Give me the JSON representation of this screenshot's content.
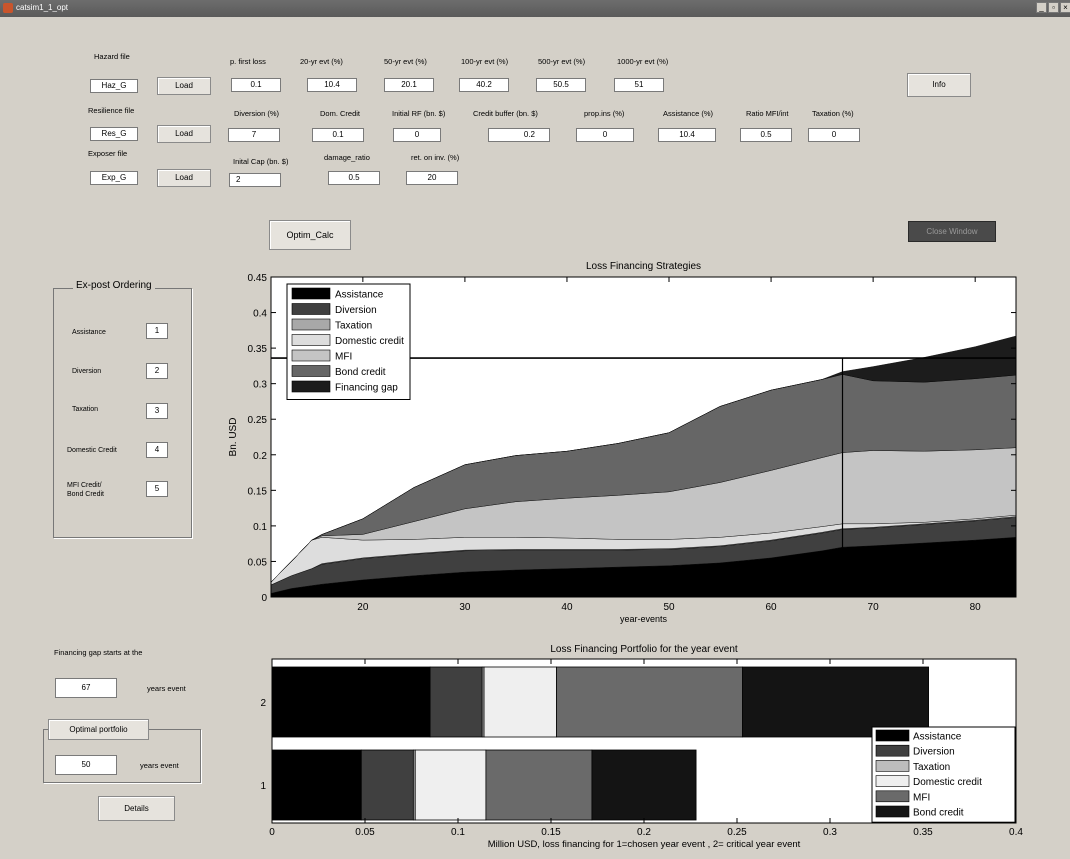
{
  "window": {
    "title": "catsim1_1_opt",
    "controls": [
      "_",
      "▫",
      "×"
    ]
  },
  "inputs": {
    "hazard_file": {
      "label": "Hazard file",
      "value": "Haz_G",
      "button": "Load"
    },
    "resilience_file": {
      "label": "Resilience file",
      "value": "Res_G",
      "button": "Load"
    },
    "exposer_file": {
      "label": "Exposer file",
      "value": "Exp_G",
      "button": "Load"
    },
    "p_first_loss": {
      "label": "p. first loss",
      "value": "0.1"
    },
    "evt20": {
      "label": "20-yr evt (%)",
      "value": "10.4"
    },
    "evt50": {
      "label": "50-yr evt (%)",
      "value": "20.1"
    },
    "evt100": {
      "label": "100-yr evt (%)",
      "value": "40.2"
    },
    "evt500": {
      "label": "500-yr evt (%)",
      "value": "50.5"
    },
    "evt1000": {
      "label": "1000-yr evt (%)",
      "value": "51"
    },
    "diversion": {
      "label": "Diversion (%)",
      "value": "7"
    },
    "dom_credit": {
      "label": "Dom. Credit",
      "value": "0.1"
    },
    "initial_rf": {
      "label": "Initial RF (bn. $)",
      "value": "0"
    },
    "credit_buffer": {
      "label": "Credit buffer (bn. $)",
      "value": "0.2"
    },
    "prop_ins": {
      "label": "prop.ins (%)",
      "value": "0"
    },
    "assistance": {
      "label": "Assistance (%)",
      "value": "10.4"
    },
    "ratio_mfi": {
      "label": "Ratio MFI/int",
      "value": "0.5"
    },
    "taxation": {
      "label": "Taxation (%)",
      "value": "0"
    },
    "initial_cap": {
      "label": "Inital Cap (bn. $)",
      "value": "2"
    },
    "damage_ratio": {
      "label": "damage_ratio",
      "value": "0.5"
    },
    "ret_on_inv": {
      "label": "ret. on inv. (%)",
      "value": "20"
    }
  },
  "buttons": {
    "info": "Info",
    "optim_calc": "Optim_Calc",
    "close_window": "Close Window",
    "optimal_portfolio": "Optimal portfolio",
    "details": "Details"
  },
  "ex_post": {
    "title": "Ex-post Ordering",
    "items": [
      {
        "label": "Assistance",
        "value": "1"
      },
      {
        "label": "Diversion",
        "value": "2"
      },
      {
        "label": "Taxation",
        "value": "3"
      },
      {
        "label": "Domestic Credit",
        "value": "4"
      },
      {
        "label": "MFI Credit/ Bond Credit",
        "value": "5"
      }
    ]
  },
  "financing_gap": {
    "label": "Financing gap starts at the",
    "value": "67",
    "suffix": "years event"
  },
  "optimal": {
    "value": "50",
    "suffix": "years event"
  },
  "colors": {
    "assistance": "#000000",
    "diversion": "#404040",
    "taxation": "#a8a8a8",
    "domestic_credit": "#dddddd",
    "mfi": "#c4c4c4",
    "bond_credit": "#666666",
    "financing_gap": "#1c1c1c"
  },
  "chart_data": [
    {
      "type": "area",
      "title": "Loss Financing Strategies",
      "xlabel": "year-events",
      "ylabel": "Bn. USD",
      "xlim": [
        11,
        84
      ],
      "ylim": [
        0,
        0.45
      ],
      "xticks": [
        20,
        30,
        40,
        50,
        60,
        70,
        80
      ],
      "yticks": [
        0,
        0.05,
        0.1,
        0.15,
        0.2,
        0.25,
        0.3,
        0.35,
        0.4,
        0.45
      ],
      "legend_position": "top-left",
      "x": [
        11,
        13,
        15,
        16,
        20,
        25,
        30,
        35,
        40,
        45,
        50,
        55,
        60,
        65,
        67,
        70,
        75,
        80,
        84
      ],
      "series": [
        {
          "name": "Assistance",
          "color": "#000000",
          "values": [
            0.005,
            0.012,
            0.016,
            0.018,
            0.024,
            0.03,
            0.035,
            0.038,
            0.04,
            0.042,
            0.044,
            0.048,
            0.055,
            0.065,
            0.07,
            0.072,
            0.076,
            0.08,
            0.084
          ]
        },
        {
          "name": "Diversion",
          "color": "#404040",
          "values": [
            0.012,
            0.018,
            0.024,
            0.028,
            0.03,
            0.03,
            0.03,
            0.028,
            0.026,
            0.024,
            0.023,
            0.023,
            0.024,
            0.025,
            0.025,
            0.025,
            0.026,
            0.027,
            0.028
          ]
        },
        {
          "name": "Taxation",
          "color": "#a8a8a8",
          "values": [
            0,
            0,
            0,
            0.001,
            0.001,
            0.001,
            0.001,
            0.001,
            0.001,
            0.001,
            0.001,
            0.001,
            0.001,
            0.001,
            0.001,
            0.001,
            0.001,
            0.001,
            0.001
          ]
        },
        {
          "name": "Domestic credit",
          "color": "#dddddd",
          "values": [
            0.004,
            0.02,
            0.04,
            0.037,
            0.025,
            0.02,
            0.018,
            0.017,
            0.016,
            0.014,
            0.013,
            0.012,
            0.01,
            0.008,
            0.007,
            0.005,
            0.002,
            0.002,
            0.002
          ]
        },
        {
          "name": "MFI",
          "color": "#c4c4c4",
          "values": [
            0,
            0,
            0,
            0.002,
            0.008,
            0.025,
            0.04,
            0.05,
            0.056,
            0.062,
            0.067,
            0.077,
            0.088,
            0.097,
            0.1,
            0.103,
            0.1,
            0.097,
            0.095
          ]
        },
        {
          "name": "Bond credit",
          "color": "#666666",
          "values": [
            0,
            0,
            0,
            0.002,
            0.022,
            0.048,
            0.062,
            0.065,
            0.066,
            0.073,
            0.083,
            0.107,
            0.113,
            0.11,
            0.11,
            0.098,
            0.097,
            0.1,
            0.102
          ]
        },
        {
          "name": "Financing gap",
          "color": "#1c1c1c",
          "values": [
            0,
            0,
            0,
            0,
            0,
            0,
            0,
            0,
            0,
            0,
            0,
            0,
            0,
            0,
            0.004,
            0.02,
            0.035,
            0.045,
            0.055
          ]
        }
      ],
      "annotations": {
        "horizontal_line_y": 0.336,
        "vertical_line_x": 67
      }
    },
    {
      "type": "bar",
      "orientation": "horizontal",
      "stacked": true,
      "title": "Loss Financing Portfolio for the year event",
      "xlabel": "Million USD, loss financing for 1=chosen year event , 2= critical year event",
      "xlim": [
        0,
        0.4
      ],
      "xticks": [
        0,
        0.05,
        0.1,
        0.15,
        0.2,
        0.25,
        0.3,
        0.35,
        0.4
      ],
      "categories": [
        "1",
        "2"
      ],
      "legend_position": "bottom-right",
      "series": [
        {
          "name": "Assistance",
          "color": "#000000",
          "values": [
            0.048,
            0.085
          ]
        },
        {
          "name": "Diversion",
          "color": "#404040",
          "values": [
            0.028,
            0.028
          ]
        },
        {
          "name": "Taxation",
          "color": "#bdbdbd",
          "values": [
            0.001,
            0.001
          ]
        },
        {
          "name": "Domestic credit",
          "color": "#efefef",
          "values": [
            0.038,
            0.039
          ]
        },
        {
          "name": "MFI",
          "color": "#6a6a6a",
          "values": [
            0.057,
            0.1
          ]
        },
        {
          "name": "Bond credit",
          "color": "#141414",
          "values": [
            0.056,
            0.1
          ]
        }
      ]
    }
  ]
}
